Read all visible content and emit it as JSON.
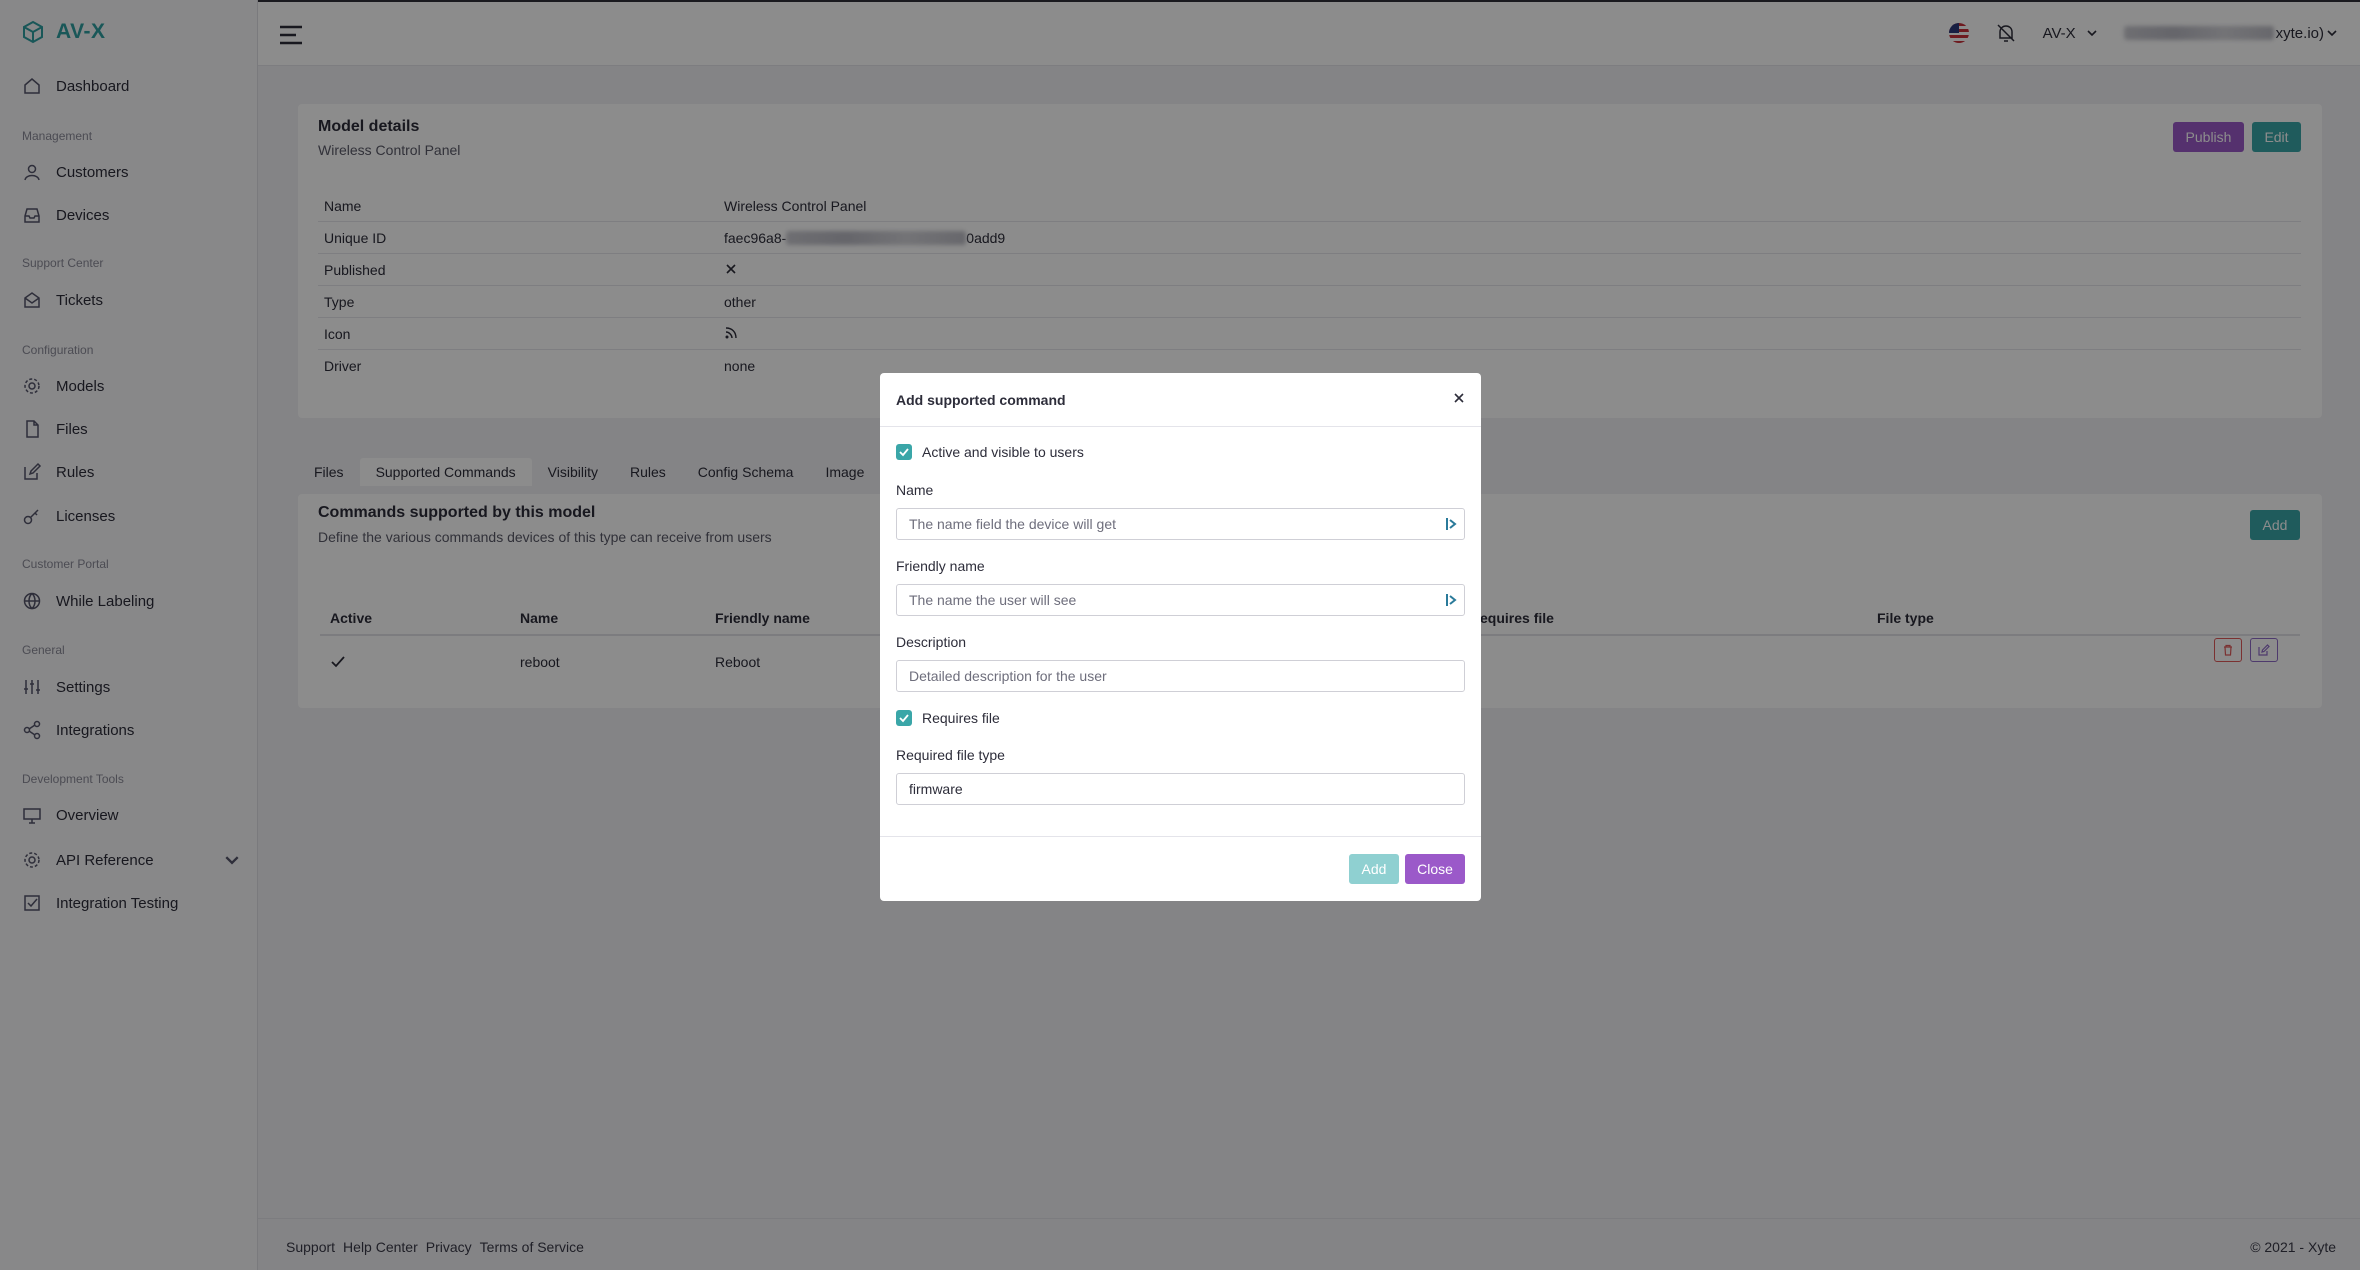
{
  "brand": {
    "name": "AV-X",
    "color": "#2f9ea0"
  },
  "sidebar": {
    "top_item": {
      "label": "Dashboard",
      "icon": "home-icon"
    },
    "sections": [
      {
        "title": "Management",
        "items": [
          {
            "label": "Customers",
            "icon": "user-icon"
          },
          {
            "label": "Devices",
            "icon": "inbox-icon"
          }
        ]
      },
      {
        "title": "Support Center",
        "items": [
          {
            "label": "Tickets",
            "icon": "mail-icon"
          }
        ]
      },
      {
        "title": "Configuration",
        "items": [
          {
            "label": "Models",
            "icon": "gear-icon"
          },
          {
            "label": "Files",
            "icon": "file-icon"
          },
          {
            "label": "Rules",
            "icon": "edit-icon"
          },
          {
            "label": "Licenses",
            "icon": "key-icon"
          }
        ]
      },
      {
        "title": "Customer Portal",
        "items": [
          {
            "label": "While Labeling",
            "icon": "globe-icon"
          }
        ]
      },
      {
        "title": "General",
        "items": [
          {
            "label": "Settings",
            "icon": "sliders-icon"
          },
          {
            "label": "Integrations",
            "icon": "share-icon"
          }
        ]
      },
      {
        "title": "Development Tools",
        "items": [
          {
            "label": "Overview",
            "icon": "monitor-icon"
          },
          {
            "label": "API Reference",
            "icon": "gear-icon"
          },
          {
            "label": "Integration Testing",
            "icon": "checkbox-icon"
          }
        ]
      }
    ]
  },
  "topbar": {
    "org": "AV-X",
    "user_suffix": "xyte.io)"
  },
  "model": {
    "title": "Model details",
    "subtitle": "Wireless Control Panel",
    "publish_label": "Publish",
    "edit_label": "Edit",
    "details": [
      {
        "key": "Name",
        "value": "Wireless Control Panel"
      },
      {
        "key": "Unique ID",
        "value_prefix": "faec96a8-",
        "value_suffix": "0add9"
      },
      {
        "key": "Published",
        "icon": "x-icon"
      },
      {
        "key": "Type",
        "value": "other"
      },
      {
        "key": "Icon",
        "icon": "rss-icon"
      },
      {
        "key": "Driver",
        "value": "none"
      }
    ]
  },
  "tabs": [
    "Files",
    "Supported Commands",
    "Visibility",
    "Rules",
    "Config Schema",
    "Image"
  ],
  "commands": {
    "title": "Commands supported by this model",
    "subtitle": "Define the various commands devices of this type can receive from users",
    "add_label": "Add",
    "columns": [
      "Active",
      "Name",
      "Friendly name",
      "equires file",
      "File type"
    ],
    "rows": [
      {
        "name": "reboot",
        "friendly_name": "Reboot"
      }
    ]
  },
  "footer": {
    "links": [
      "Support",
      "Help Center",
      "Privacy",
      "Terms of Service"
    ],
    "copyright": "© 2021 - Xyte"
  },
  "modal": {
    "title": "Add supported command",
    "active_label": "Active and visible to users",
    "name_label": "Name",
    "name_placeholder": "The name field the device will get",
    "friendly_label": "Friendly name",
    "friendly_placeholder": "The name the user will see",
    "description_label": "Description",
    "description_placeholder": "Detailed description for the user",
    "requires_file_label": "Requires file",
    "file_type_label": "Required file type",
    "file_type_value": "firmware",
    "add_label": "Add",
    "close_label": "Close"
  }
}
